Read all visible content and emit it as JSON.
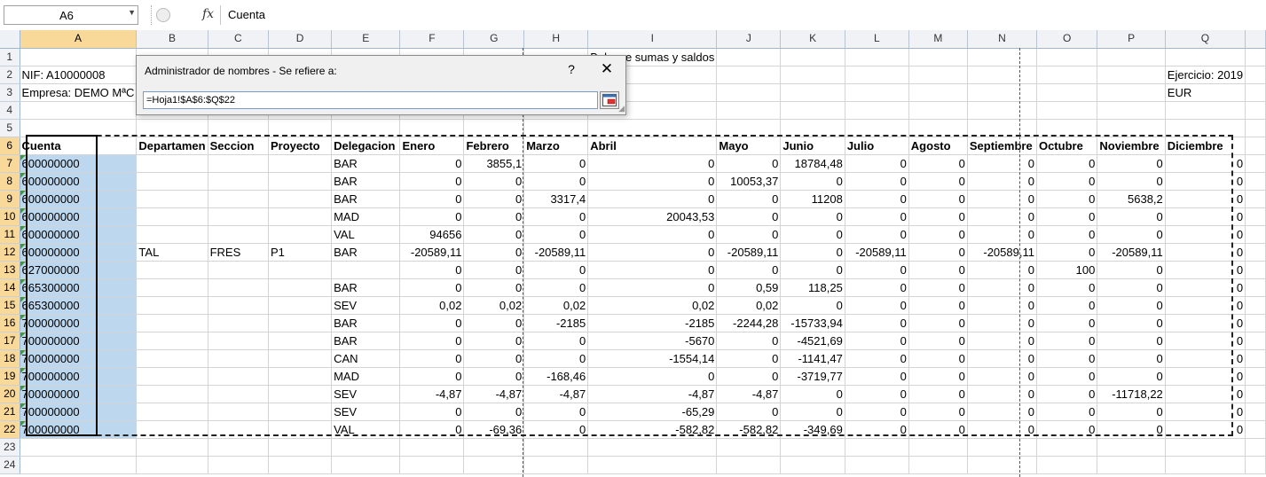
{
  "name_box": "A6",
  "formula_bar": "Cuenta",
  "columns": [
    "A",
    "B",
    "C",
    "D",
    "E",
    "F",
    "G",
    "H",
    "I",
    "J",
    "K",
    "L",
    "M",
    "N",
    "O",
    "P",
    "Q"
  ],
  "rows": [
    "1",
    "2",
    "3",
    "4",
    "5",
    "6",
    "7",
    "8",
    "9",
    "10",
    "11",
    "12",
    "13",
    "14",
    "15",
    "16",
    "17",
    "18",
    "19",
    "20",
    "21",
    "22",
    "23",
    "24"
  ],
  "header_cells": {
    "title": "Balance sumas y saldos",
    "nif": "NIF: A10000008",
    "empresa": "Empresa: DEMO MªC",
    "ejercicio": "Ejercicio: 2019",
    "moneda": "EUR"
  },
  "table_headers": [
    "Cuenta",
    "Departamen",
    "Seccion",
    "Proyecto",
    "Delegacion",
    "Enero",
    "Febrero",
    "Marzo",
    "Abril",
    "Mayo",
    "Junio",
    "Julio",
    "Agosto",
    "Septiembre",
    "Octubre",
    "Noviembre",
    "Diciembre"
  ],
  "table_rows": [
    [
      "600000000",
      "",
      "",
      "",
      "BAR",
      "0",
      "3855,1",
      "0",
      "0",
      "0",
      "18784,48",
      "0",
      "0",
      "0",
      "0",
      "0",
      "0"
    ],
    [
      "600000000",
      "",
      "",
      "",
      "BAR",
      "0",
      "0",
      "0",
      "0",
      "10053,37",
      "0",
      "0",
      "0",
      "0",
      "0",
      "0",
      "0"
    ],
    [
      "600000000",
      "",
      "",
      "",
      "BAR",
      "0",
      "0",
      "3317,4",
      "0",
      "0",
      "11208",
      "0",
      "0",
      "0",
      "0",
      "5638,2",
      "0"
    ],
    [
      "600000000",
      "",
      "",
      "",
      "MAD",
      "0",
      "0",
      "0",
      "20043,53",
      "0",
      "0",
      "0",
      "0",
      "0",
      "0",
      "0",
      "0"
    ],
    [
      "600000000",
      "",
      "",
      "",
      "VAL",
      "94656",
      "0",
      "0",
      "0",
      "0",
      "0",
      "0",
      "0",
      "0",
      "0",
      "0",
      "0"
    ],
    [
      "600000000",
      "TAL",
      "FRES",
      "P1",
      "BAR",
      "-20589,11",
      "0",
      "-20589,11",
      "0",
      "-20589,11",
      "0",
      "-20589,11",
      "0",
      "-20589,11",
      "0",
      "-20589,11",
      "0"
    ],
    [
      "627000000",
      "",
      "",
      "",
      "",
      "0",
      "0",
      "0",
      "0",
      "0",
      "0",
      "0",
      "0",
      "0",
      "100",
      "0",
      "0"
    ],
    [
      "665300000",
      "",
      "",
      "",
      "BAR",
      "0",
      "0",
      "0",
      "0",
      "0,59",
      "118,25",
      "0",
      "0",
      "0",
      "0",
      "0",
      "0"
    ],
    [
      "665300000",
      "",
      "",
      "",
      "SEV",
      "0,02",
      "0,02",
      "0,02",
      "0,02",
      "0,02",
      "0",
      "0",
      "0",
      "0",
      "0",
      "0",
      "0"
    ],
    [
      "700000000",
      "",
      "",
      "",
      "BAR",
      "0",
      "0",
      "-2185",
      "-2185",
      "-2244,28",
      "-15733,94",
      "0",
      "0",
      "0",
      "0",
      "0",
      "0"
    ],
    [
      "700000000",
      "",
      "",
      "",
      "BAR",
      "0",
      "0",
      "0",
      "-5670",
      "0",
      "-4521,69",
      "0",
      "0",
      "0",
      "0",
      "0",
      "0"
    ],
    [
      "700000000",
      "",
      "",
      "",
      "CAN",
      "0",
      "0",
      "0",
      "-1554,14",
      "0",
      "-1141,47",
      "0",
      "0",
      "0",
      "0",
      "0",
      "0"
    ],
    [
      "700000000",
      "",
      "",
      "",
      "MAD",
      "0",
      "0",
      "-168,46",
      "0",
      "0",
      "-3719,77",
      "0",
      "0",
      "0",
      "0",
      "0",
      "0"
    ],
    [
      "700000000",
      "",
      "",
      "",
      "SEV",
      "-4,87",
      "-4,87",
      "-4,87",
      "-4,87",
      "-4,87",
      "0",
      "0",
      "0",
      "0",
      "0",
      "-11718,22",
      "0"
    ],
    [
      "700000000",
      "",
      "",
      "",
      "SEV",
      "0",
      "0",
      "0",
      "-65,29",
      "0",
      "0",
      "0",
      "0",
      "0",
      "0",
      "0",
      "0"
    ],
    [
      "700000000",
      "",
      "",
      "",
      "VAL",
      "0",
      "-69,36",
      "0",
      "-582,82",
      "-582,82",
      "-349,69",
      "0",
      "0",
      "0",
      "0",
      "0",
      "0"
    ]
  ],
  "dialog": {
    "title": "Administrador de nombres - Se refiere a:",
    "help": "?",
    "close": "✕",
    "refers_to": "=Hoja1!$A$6:$Q$22",
    "collapse_icon": "range-select-icon"
  }
}
